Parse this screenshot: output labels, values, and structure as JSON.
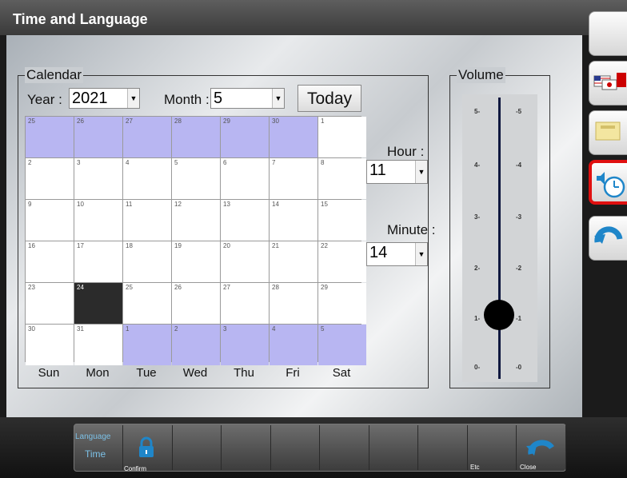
{
  "window": {
    "title": "Time and Language"
  },
  "calendar": {
    "group_label": "Calendar",
    "year_label": "Year :",
    "year_value": "2021",
    "month_label": "Month :",
    "month_value": "5",
    "today_button": "Today",
    "weekdays": [
      "Sun",
      "Mon",
      "Tue",
      "Wed",
      "Thu",
      "Fri",
      "Sat"
    ],
    "weeks": [
      [
        {
          "d": "25",
          "o": true
        },
        {
          "d": "26",
          "o": true
        },
        {
          "d": "27",
          "o": true
        },
        {
          "d": "28",
          "o": true
        },
        {
          "d": "29",
          "o": true
        },
        {
          "d": "30",
          "o": true
        },
        {
          "d": "1",
          "o": false
        }
      ],
      [
        {
          "d": "2",
          "o": false
        },
        {
          "d": "3",
          "o": false
        },
        {
          "d": "4",
          "o": false
        },
        {
          "d": "5",
          "o": false
        },
        {
          "d": "6",
          "o": false
        },
        {
          "d": "7",
          "o": false
        },
        {
          "d": "8",
          "o": false
        }
      ],
      [
        {
          "d": "9",
          "o": false
        },
        {
          "d": "10",
          "o": false
        },
        {
          "d": "11",
          "o": false
        },
        {
          "d": "12",
          "o": false
        },
        {
          "d": "13",
          "o": false
        },
        {
          "d": "14",
          "o": false
        },
        {
          "d": "15",
          "o": false
        }
      ],
      [
        {
          "d": "16",
          "o": false
        },
        {
          "d": "17",
          "o": false
        },
        {
          "d": "18",
          "o": false
        },
        {
          "d": "19",
          "o": false
        },
        {
          "d": "20",
          "o": false
        },
        {
          "d": "21",
          "o": false
        },
        {
          "d": "22",
          "o": false
        }
      ],
      [
        {
          "d": "23",
          "o": false
        },
        {
          "d": "24",
          "o": false,
          "sel": true
        },
        {
          "d": "25",
          "o": false
        },
        {
          "d": "26",
          "o": false
        },
        {
          "d": "27",
          "o": false
        },
        {
          "d": "28",
          "o": false
        },
        {
          "d": "29",
          "o": false
        }
      ],
      [
        {
          "d": "30",
          "o": false
        },
        {
          "d": "31",
          "o": false
        },
        {
          "d": "1",
          "o": true
        },
        {
          "d": "2",
          "o": true
        },
        {
          "d": "3",
          "o": true
        },
        {
          "d": "4",
          "o": true
        },
        {
          "d": "5",
          "o": true
        }
      ]
    ]
  },
  "time": {
    "hour_label": "Hour :",
    "hour_value": "11",
    "minute_label": "Minute :",
    "minute_value": "14"
  },
  "volume": {
    "group_label": "Volume",
    "left_ticks": [
      "5-",
      "4-",
      "3-",
      "2-",
      "1-",
      "0-"
    ],
    "right_ticks": [
      "-5",
      "-4",
      "-3",
      "-2",
      "-1",
      "-0"
    ],
    "level": 1
  },
  "sidebar": {
    "buttons": [
      {
        "icon": "blank-icon"
      },
      {
        "icon": "language-flags-icon"
      },
      {
        "icon": "network-port-icon"
      },
      {
        "icon": "volume-clock-icon",
        "active": true
      },
      {
        "icon": "back-arrow-icon"
      }
    ]
  },
  "bottombar": {
    "language_label": "Language",
    "time_label": "Time",
    "confirm_label": "Confirm",
    "etc_label": "Etc",
    "close_label": "Close"
  },
  "colors": {
    "other_month_cell": "#b8b6f2",
    "selected_cell": "#2b2b2b",
    "active_border": "#e01010",
    "bottom_text": "#7cc0e6",
    "icon_blue": "#1f86c9"
  }
}
